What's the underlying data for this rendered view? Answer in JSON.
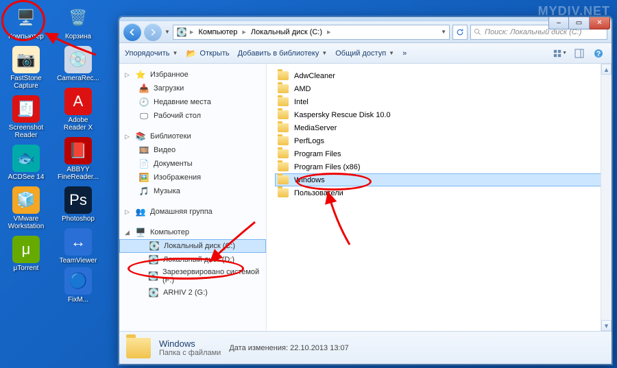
{
  "watermark": "MYDIV.NET",
  "desktop": {
    "col1": [
      {
        "label": "Компьютер",
        "icon": "🖥️",
        "bg": "transparent"
      },
      {
        "label": "FastStone Capture",
        "icon": "📷",
        "bg": "#ffefc6"
      },
      {
        "label": "Screenshot Reader",
        "icon": "🧾",
        "bg": "#d11"
      },
      {
        "label": "ACDSee 14",
        "icon": "🐟",
        "bg": "#0aa"
      },
      {
        "label": "VMware Workstation",
        "icon": "🧊",
        "bg": "#f5a623"
      },
      {
        "label": "μTorrent",
        "icon": "μ",
        "bg": "#6a0"
      }
    ],
    "col2": [
      {
        "label": "Корзина",
        "icon": "🗑️",
        "bg": "transparent"
      },
      {
        "label": "CameraRec...",
        "icon": "💿",
        "bg": "#cfd8e6"
      },
      {
        "label": "Adobe Reader X",
        "icon": "A",
        "bg": "#d11"
      },
      {
        "label": "ABBYY FineReader...",
        "icon": "📕",
        "bg": "#b00"
      },
      {
        "label": "Photoshop",
        "icon": "Ps",
        "bg": "#0a1f3a"
      },
      {
        "label": "TeamViewer",
        "icon": "↔",
        "bg": "#2a6fd6"
      }
    ],
    "col3": [
      {
        "label": "FixM...",
        "icon": "🔵",
        "bg": "#2a6fd6"
      }
    ]
  },
  "titlebar": {
    "minimize": "–",
    "maximize": "▭",
    "close": "✕"
  },
  "address": {
    "crumbs": [
      "Компьютер",
      "Локальный диск (C:)"
    ],
    "sep": "▸"
  },
  "search": {
    "placeholder": "Поиск: Локальный диск (C:)"
  },
  "toolbar": {
    "organize": "Упорядочить",
    "open": "Открыть",
    "add_library": "Добавить в библиотеку",
    "share": "Общий доступ",
    "more": "»"
  },
  "sidebar": {
    "favorites": {
      "label": "Избранное",
      "items": [
        "Загрузки",
        "Недавние места",
        "Рабочий стол"
      ]
    },
    "libraries": {
      "label": "Библиотеки",
      "items": [
        "Видео",
        "Документы",
        "Изображения",
        "Музыка"
      ]
    },
    "homegroup": {
      "label": "Домашняя группа"
    },
    "computer": {
      "label": "Компьютер",
      "items": [
        "Локальный диск (C:)",
        "Локальный диск (D:)",
        "Зарезервировано системой (F:)",
        "ARHIV 2 (G:)"
      ],
      "selected": 0
    }
  },
  "files": {
    "items": [
      "AdwCleaner",
      "AMD",
      "Intel",
      "Kaspersky Rescue Disk 10.0",
      "MediaServer",
      "PerfLogs",
      "Program Files",
      "Program Files (x86)",
      "Windows",
      "Пользователи"
    ],
    "selected": 8
  },
  "details": {
    "name": "Windows",
    "type": "Папка с файлами",
    "modified_label": "Дата изменения:",
    "modified_value": "22.10.2013 13:07"
  }
}
